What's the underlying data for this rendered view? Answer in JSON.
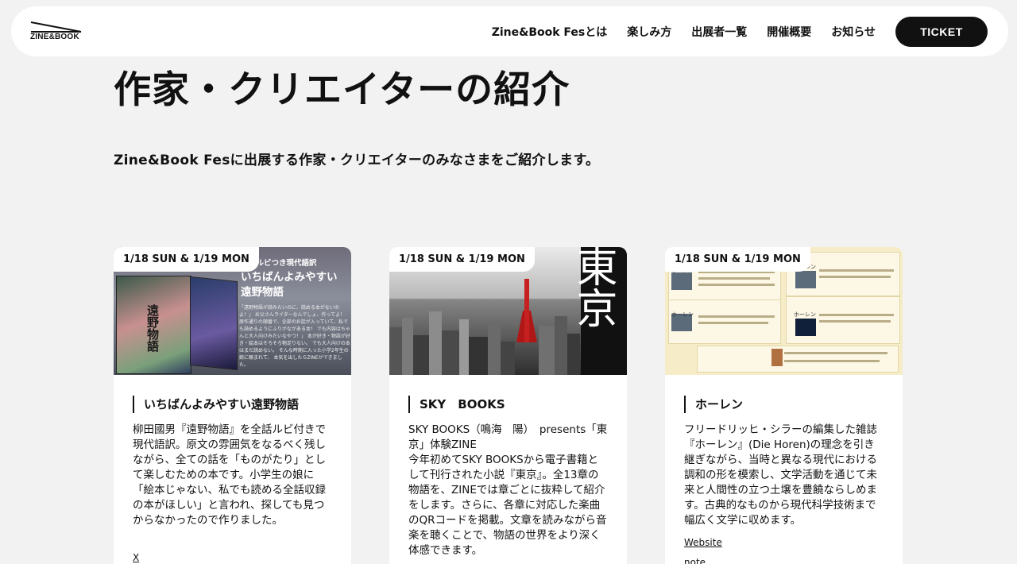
{
  "header": {
    "logo_text": "ZINE&BOOK",
    "nav": [
      {
        "label": "Zine&Book Fesとは"
      },
      {
        "label": "楽しみ方"
      },
      {
        "label": "出展者一覧"
      },
      {
        "label": "開催概要"
      },
      {
        "label": "お知らせ"
      }
    ],
    "ticket_label": "TICKET"
  },
  "main": {
    "title": "作家・クリエイターの紹介",
    "intro": "Zine&Book Fesに出展する作家・クリエイターのみなさまをご紹介します。"
  },
  "cards": [
    {
      "date": "1/18 SUN & 1/19 MON",
      "title": "いちばんよみやすい遠野物語",
      "description": "柳田國男『遠野物語』を全話ルビ付きで現代語訳。原文の雰囲気をなるべく残しながら、全ての話を「ものがたり」として楽しむための本です。小学生の娘に「絵本じゃない、私でも読める全話収録の本がほしい」と言われ、探しても見つからなかったので作りました。",
      "links": [
        "X"
      ],
      "image": {
        "head": "話ルビつき現代語訳",
        "big1": "いちばんよみやすい",
        "big2": "遠野物語",
        "book_title": "遠野物語",
        "small": "「遠野物語が読みたいのに、読める本がないのよ！」 お父さんライターなんでしょ、作ってよ！ 原作通りの順番で、全部のお話が入っていて、私でも読めるようにふりがながある本！ でも内容はちゃんと大人向けみたいなやつ！」 本が好き・物語が好き・絵本はそろそろ物足りない。 でも大人向けの本はまだ読めない。 そんな時期に入った小学2年生の娘に頼まれて、 本気を出したらZINEができました。"
      }
    },
    {
      "date": "1/18 SUN & 1/19 MON",
      "title": "SKY　BOOKS",
      "description": "SKY BOOKS（鳴海　陽）　presents「東京」体験ZINE\n今年初めてSKY BOOKSから電子書籍として刊行された小説『東京』。全13章の物語を、ZINEでは章ごとに抜粋して紹介をします。さらに、各章に対応した楽曲のQRコードを掲載。文章を読みながら音楽を聴くことで、物語の世界をより深く体感できます。",
      "links": [],
      "image": {
        "vertical_text": "東京"
      }
    },
    {
      "date": "1/18 SUN & 1/19 MON",
      "title": "ホーレン",
      "description": "フリードリッヒ・シラーの編集した雑誌『ホーレン』(Die Horen)の理念を引き継ぎながら、当時と異なる現代における調和の形を模索し、文学活動を通じて未来と人間性の立つ土壌を豊饒ならしめます。古典的なものから現代科学技術まで幅広く文学に収めます。",
      "links": [
        "Website",
        "note"
      ],
      "image": {
        "label1": "ホーレン",
        "label2": "ホーレン",
        "label3": "ホーレン",
        "label4": "ホーレン"
      }
    }
  ],
  "colors": {
    "background": "#f2f2f2",
    "accent": "#111111",
    "tower_red": "#c62020"
  }
}
